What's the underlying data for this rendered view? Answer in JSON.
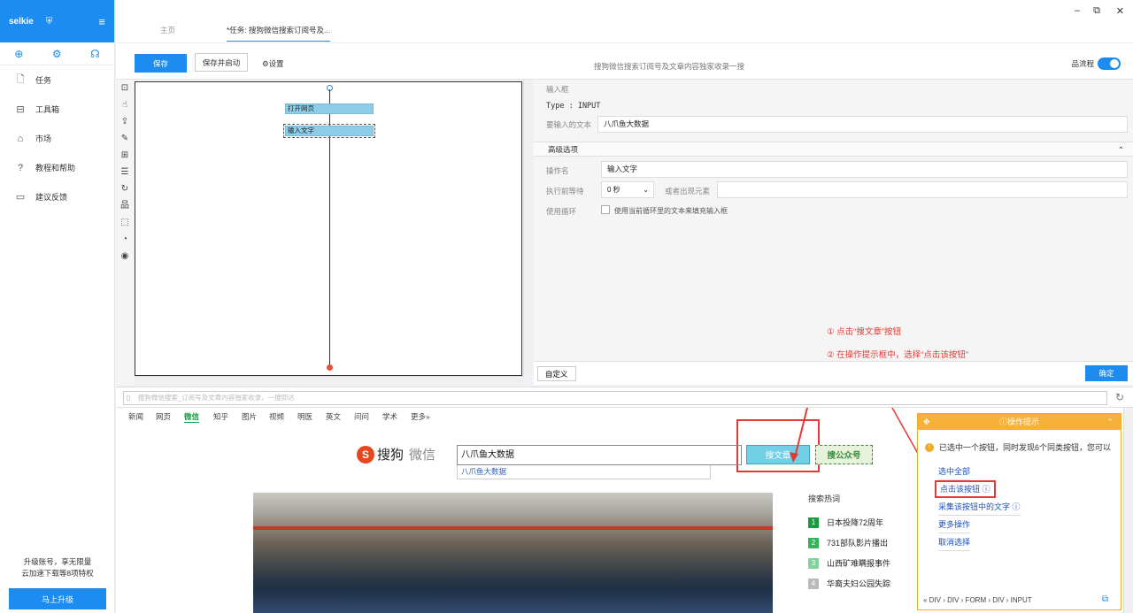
{
  "sidebar": {
    "brand": "selkie",
    "shield_glyph": "⛨",
    "menu_glyph": "≡",
    "quick_icons": [
      "plus-circle-icon",
      "gear-icon",
      "headset-icon"
    ],
    "items": [
      {
        "label": "任务",
        "icon": "file-icon"
      },
      {
        "label": "工具箱",
        "icon": "toolbox-icon"
      },
      {
        "label": "市场",
        "icon": "shop-bag-icon"
      },
      {
        "label": "教程和帮助",
        "icon": "help-circle-icon"
      },
      {
        "label": "建议反馈",
        "icon": "feedback-icon"
      }
    ],
    "upgrade_line1": "升级账号，享无限量",
    "upgrade_line2": "云加速下载等8项特权",
    "upgrade_button": "马上升级"
  },
  "tabs": {
    "home": "主页",
    "task": "*任务: 搜狗微信搜索订阅号及..."
  },
  "toolbar": {
    "save": "保存",
    "save_start": "保存并启动",
    "settings": "设置",
    "task_title": "搜狗微信搜索订阅号及文章内容独家收录一搜",
    "flow_label": "流程"
  },
  "flow": {
    "nodes": [
      "打开网页",
      "输入文字"
    ]
  },
  "props": {
    "section_title": "输入框",
    "type_text": "Type : INPUT",
    "text_label": "要输入的文本",
    "text_value": "八爪鱼大数据",
    "advanced": "高级选项",
    "op_name_label": "操作名",
    "op_name_value": "输入文字",
    "wait_label": "执行前等待",
    "wait_value": "0 秒",
    "appear_label": "或者出现元素",
    "loop_label": "使用循环",
    "loop_checkbox_text": "使用当前循环里的文本来填充输入框",
    "custom_button": "自定义",
    "ok_button": "确定"
  },
  "annotations": {
    "step1": "① 点击“搜文章”按钮",
    "step2": "② 在操作提示框中，选择“点击该按钮”"
  },
  "browser": {
    "address": "搜狗微信搜索_订阅号及文章内容独家收录，一搜即达",
    "nav": [
      "新闻",
      "网页",
      "微信",
      "知乎",
      "图片",
      "视频",
      "明医",
      "英文",
      "问问",
      "学术",
      "更多»"
    ],
    "nav_active_index": 2,
    "logo_text": "搜狗",
    "logo_sub": "微信",
    "search_value": "八爪鱼大数据",
    "suggest": "八爪鱼大数据",
    "btn_article": "搜文章",
    "btn_account": "搜公众号",
    "hot_title": "搜索热词",
    "hot_items": [
      {
        "num": "1",
        "text": "日本投降72周年",
        "color": "#1a9d3e"
      },
      {
        "num": "2",
        "text": "731部队影片播出",
        "color": "#35b35a"
      },
      {
        "num": "3",
        "text": "山西矿难瞒报事件",
        "color": "#86d19b"
      },
      {
        "num": "4",
        "text": "华裔夫妇公园失踪",
        "color": "#bbbbbb"
      }
    ]
  },
  "hint": {
    "title": "操作提示",
    "message": "已选中一个按钮，同时发现6个同类按钮，您可以",
    "select_all": "选中全部",
    "click_button": "点击该按钮",
    "collect_text": "采集该按钮中的文字",
    "more_ops": "更多操作",
    "cancel": "取消选择",
    "path": "«  DIV  ›  DIV  ›  FORM  ›  DIV  ›  INPUT"
  },
  "colors": {
    "accent": "#1c8cf0",
    "annotation": "#e53935",
    "hint_header": "#f7b13a",
    "sogou_green": "#1a9d3e"
  }
}
